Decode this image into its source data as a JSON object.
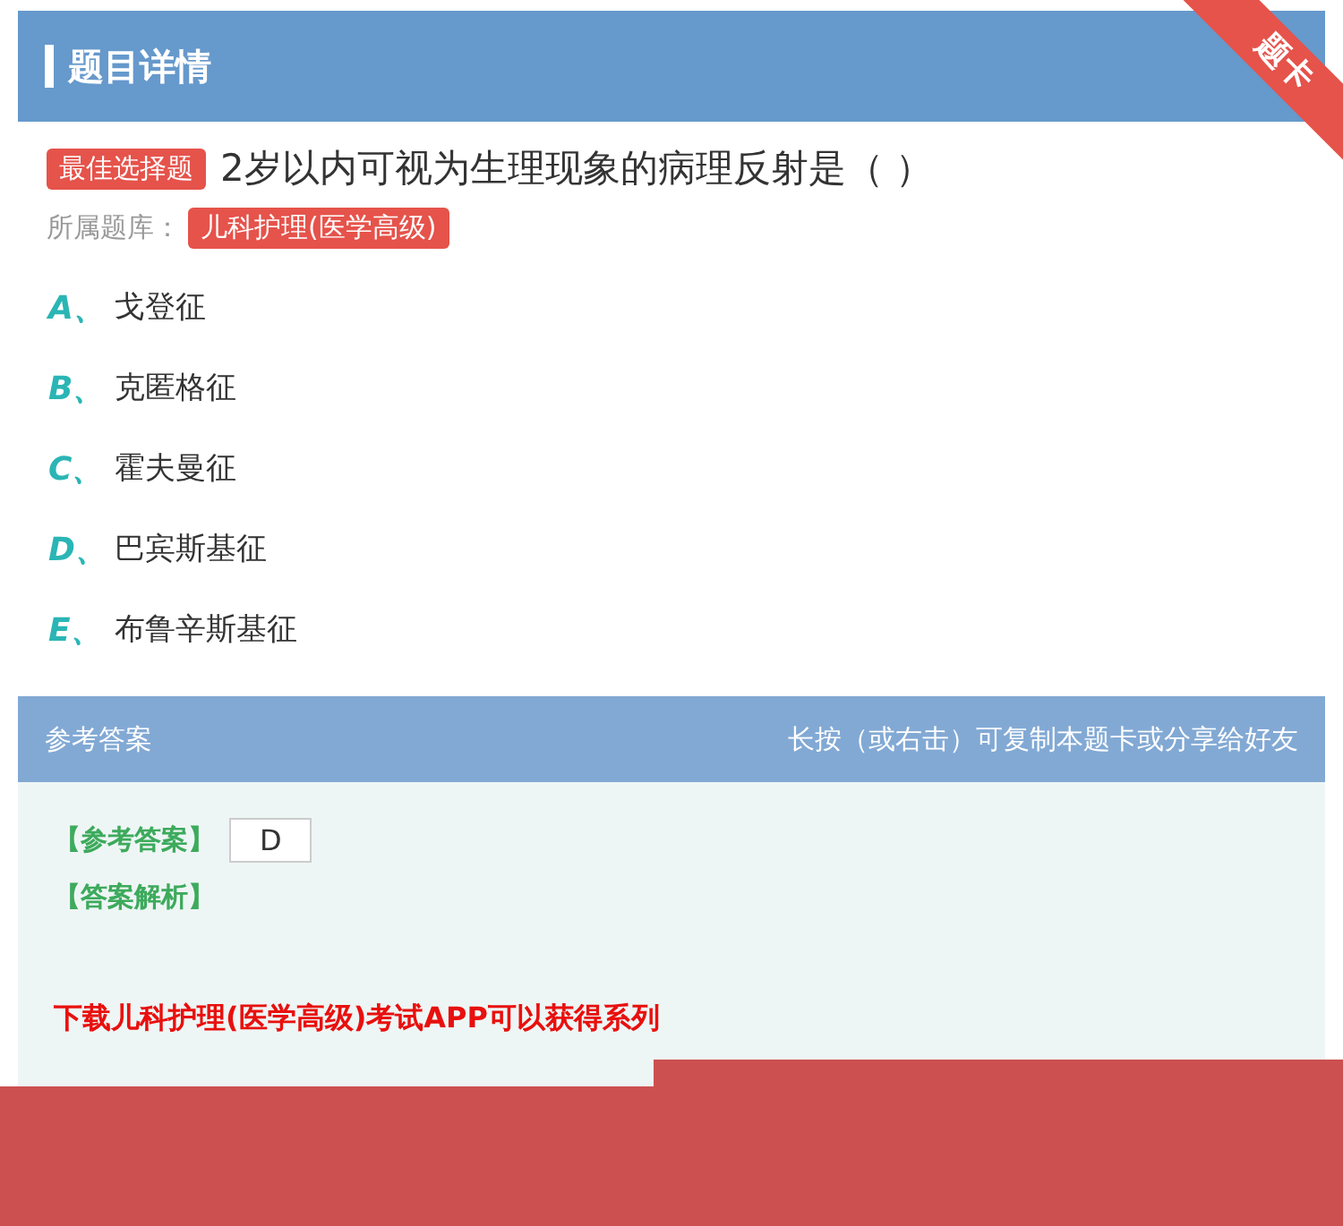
{
  "header": {
    "title": "题目详情",
    "ribbon": "题卡"
  },
  "question": {
    "type_badge": "最佳选择题",
    "text": "2岁以内可视为生理现象的病理反射是（ ）",
    "bank_label": "所属题库：",
    "bank": "儿科护理(医学高级)"
  },
  "options": [
    {
      "letter": "A、",
      "text": "戈登征"
    },
    {
      "letter": "B、",
      "text": "克匿格征"
    },
    {
      "letter": "C、",
      "text": "霍夫曼征"
    },
    {
      "letter": "D、",
      "text": "巴宾斯基征"
    },
    {
      "letter": "E、",
      "text": "布鲁辛斯基征"
    }
  ],
  "answer_section": {
    "title": "参考答案",
    "hint": "长按（或右击）可复制本题卡或分享给好友",
    "answer_label": "【参考答案】",
    "answer": "D",
    "analysis_label": "【答案解析】",
    "promo": "下载儿科护理(医学高级)考试APP可以获得系列"
  }
}
